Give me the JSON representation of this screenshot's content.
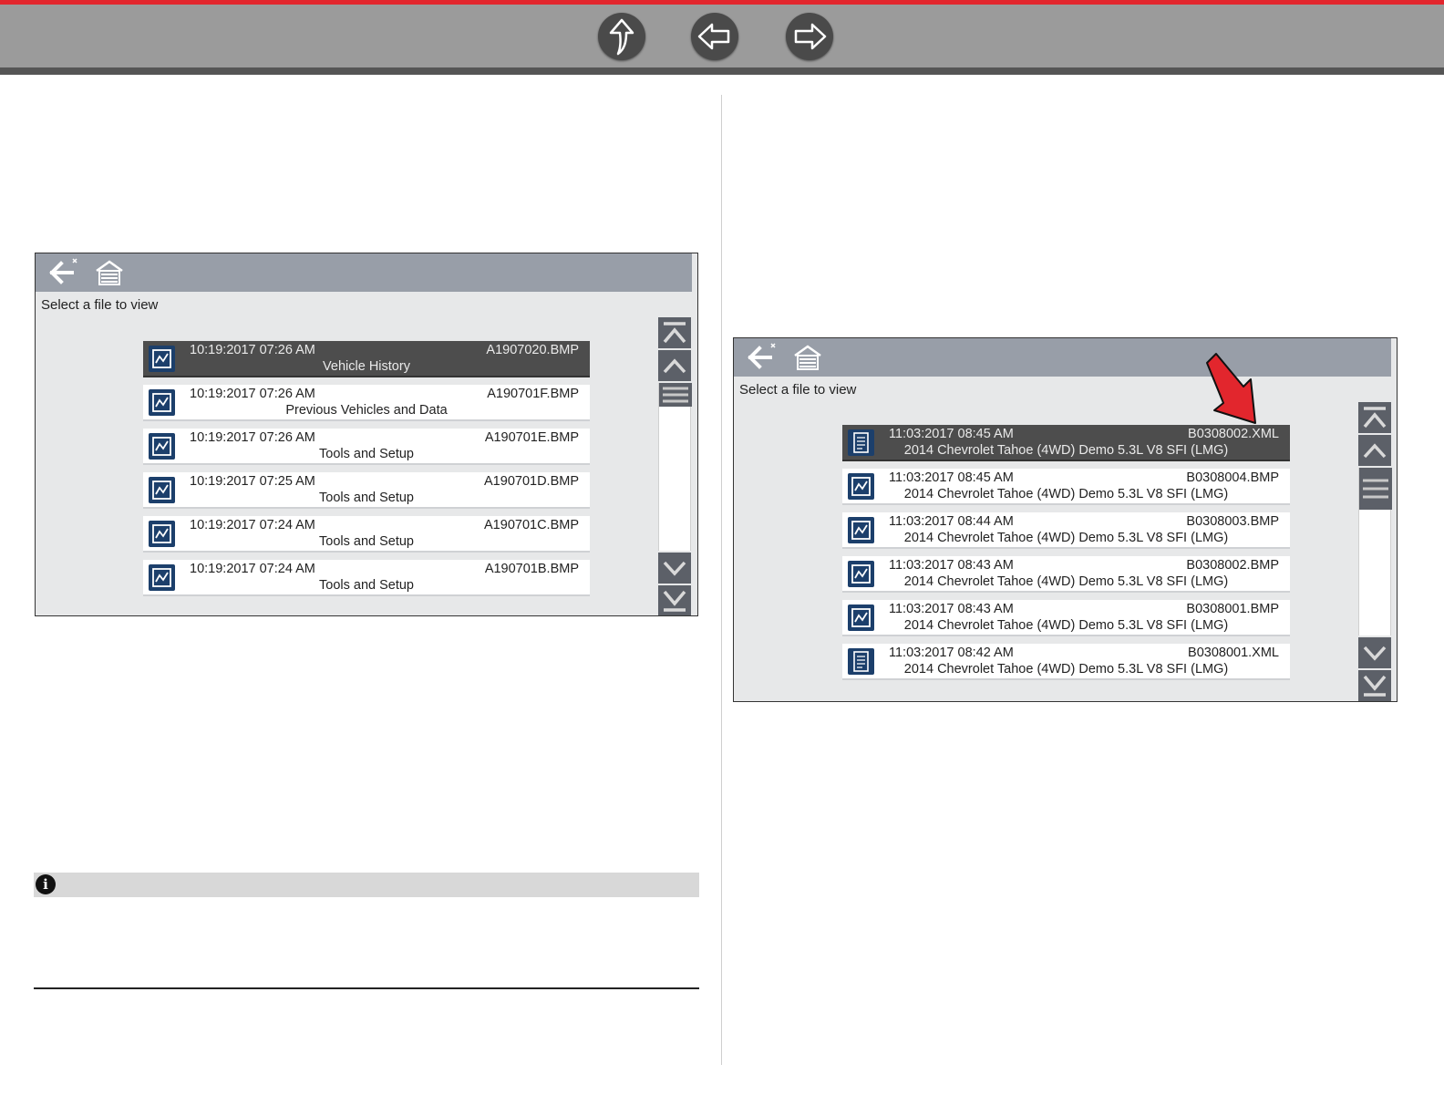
{
  "colors": {
    "accent_red": "#e2262d",
    "toolbar_gray": "#9b9b9b",
    "header_slate": "#989ea8",
    "icon_blue": "#1c3f6b",
    "selected_row": "#4d4d4d"
  },
  "nav": {
    "up_icon": "up-arrow-icon",
    "back_icon": "left-arrow-icon",
    "forward_icon": "right-arrow-icon"
  },
  "left_panel": {
    "prompt": "Select a file to view",
    "files": [
      {
        "timestamp": "10:19:2017 07:26 AM",
        "filename": "A1907020.BMP",
        "description": "Vehicle History",
        "icon": "image-file-icon",
        "selected": true
      },
      {
        "timestamp": "10:19:2017 07:26 AM",
        "filename": "A190701F.BMP",
        "description": "Previous Vehicles and Data",
        "icon": "image-file-icon",
        "selected": false
      },
      {
        "timestamp": "10:19:2017 07:26 AM",
        "filename": "A190701E.BMP",
        "description": "Tools and Setup",
        "icon": "image-file-icon",
        "selected": false
      },
      {
        "timestamp": "10:19:2017 07:25 AM",
        "filename": "A190701D.BMP",
        "description": "Tools and Setup",
        "icon": "image-file-icon",
        "selected": false
      },
      {
        "timestamp": "10:19:2017 07:24 AM",
        "filename": "A190701C.BMP",
        "description": "Tools and Setup",
        "icon": "image-file-icon",
        "selected": false
      },
      {
        "timestamp": "10:19:2017 07:24 AM",
        "filename": "A190701B.BMP",
        "description": "Tools and Setup",
        "icon": "image-file-icon",
        "selected": false
      }
    ]
  },
  "right_panel": {
    "prompt": "Select a file to view",
    "files": [
      {
        "timestamp": "11:03:2017 08:45 AM",
        "filename": "B0308002.XML",
        "description": "2014 Chevrolet Tahoe (4WD) Demo 5.3L V8 SFI (LMG)",
        "icon": "xml-file-icon",
        "selected": true
      },
      {
        "timestamp": "11:03:2017 08:45 AM",
        "filename": "B0308004.BMP",
        "description": "2014 Chevrolet Tahoe (4WD) Demo 5.3L V8 SFI (LMG)",
        "icon": "image-file-icon",
        "selected": false
      },
      {
        "timestamp": "11:03:2017 08:44 AM",
        "filename": "B0308003.BMP",
        "description": "2014 Chevrolet Tahoe (4WD) Demo 5.3L V8 SFI (LMG)",
        "icon": "image-file-icon",
        "selected": false
      },
      {
        "timestamp": "11:03:2017 08:43 AM",
        "filename": "B0308002.BMP",
        "description": "2014 Chevrolet Tahoe (4WD) Demo 5.3L V8 SFI (LMG)",
        "icon": "image-file-icon",
        "selected": false
      },
      {
        "timestamp": "11:03:2017 08:43 AM",
        "filename": "B0308001.BMP",
        "description": "2014 Chevrolet Tahoe (4WD) Demo 5.3L V8 SFI (LMG)",
        "icon": "image-file-icon",
        "selected": false
      },
      {
        "timestamp": "11:03:2017 08:42 AM",
        "filename": "B0308001.XML",
        "description": "2014 Chevrolet Tahoe (4WD) Demo 5.3L V8 SFI (LMG)",
        "icon": "xml-file-icon",
        "selected": false
      }
    ]
  },
  "note": {
    "icon": "info-icon"
  }
}
